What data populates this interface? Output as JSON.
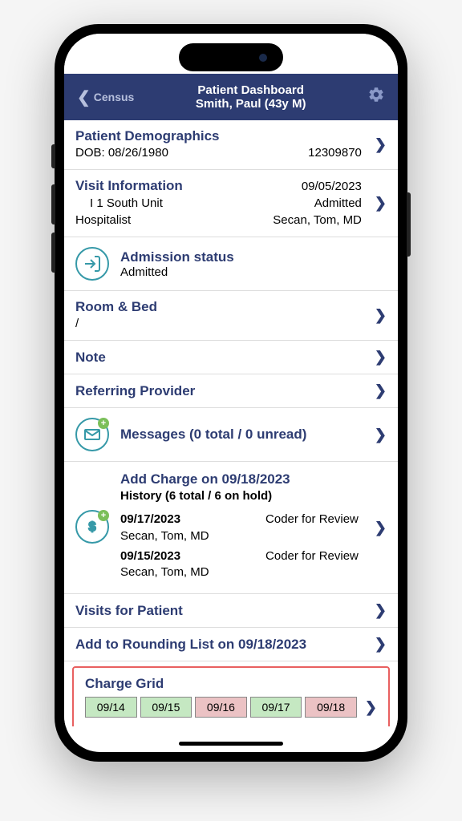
{
  "header": {
    "back_label": "Census",
    "title": "Patient Dashboard",
    "subtitle": "Smith, Paul (43y M)"
  },
  "demographics": {
    "title": "Patient Demographics",
    "dob_label": "DOB: 08/26/1980",
    "mrn": "12309870"
  },
  "visit": {
    "title": "Visit Information",
    "unit": "I 1 South Unit",
    "service": "Hospitalist",
    "date": "09/05/2023",
    "status": "Admitted",
    "provider": "Secan, Tom, MD"
  },
  "admission": {
    "label": "Admission status",
    "value": "Admitted"
  },
  "room": {
    "title": "Room & Bed",
    "value": "/"
  },
  "note": {
    "title": "Note"
  },
  "referring": {
    "title": "Referring Provider"
  },
  "messages": {
    "title": "Messages (0 total / 0 unread)"
  },
  "charges": {
    "add_title": "Add Charge on 09/18/2023",
    "history_label": "History (6 total / 6 on hold)",
    "entries": [
      {
        "date": "09/17/2023",
        "status": "Coder for Review",
        "provider": "Secan, Tom, MD"
      },
      {
        "date": "09/15/2023",
        "status": "Coder for Review",
        "provider": "Secan, Tom, MD"
      }
    ]
  },
  "visits_list": {
    "title": "Visits for Patient"
  },
  "rounding": {
    "title": "Add to Rounding List on 09/18/2023"
  },
  "charge_grid": {
    "title": "Charge Grid",
    "cells": [
      {
        "label": "09/14",
        "status": "green"
      },
      {
        "label": "09/15",
        "status": "green"
      },
      {
        "label": "09/16",
        "status": "pink"
      },
      {
        "label": "09/17",
        "status": "green"
      },
      {
        "label": "09/18",
        "status": "pink"
      }
    ]
  }
}
